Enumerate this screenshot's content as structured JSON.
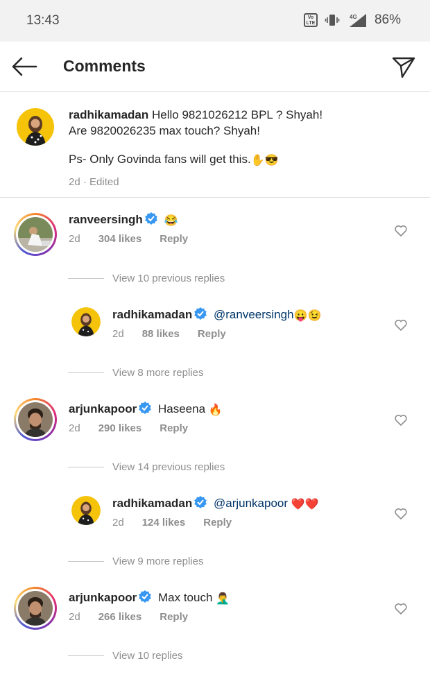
{
  "status": {
    "time": "13:43",
    "battery": "86%",
    "network": "4G",
    "volte": "VoLTE"
  },
  "header": {
    "title": "Comments"
  },
  "caption": {
    "username": "radhikamadan",
    "line1": "Hello 9821026212 BPL ? Shyah!",
    "line2": "Are 9820026235 max touch? Shyah!",
    "line3": "Ps- Only Govinda fans will get this.",
    "emoji": "✋😎",
    "meta": "2d · Edited"
  },
  "comments": [
    {
      "username": "ranveersingh",
      "text": "",
      "emoji": "😂",
      "age": "2d",
      "likes": "304 likes",
      "reply": "Reply"
    },
    {
      "username": "radhikamadan",
      "text": "@ranveersingh",
      "emoji": "😛😉",
      "age": "2d",
      "likes": "88 likes",
      "reply": "Reply"
    },
    {
      "username": "arjunkapoor",
      "text": "Haseena",
      "emoji": "🔥",
      "age": "2d",
      "likes": "290 likes",
      "reply": "Reply"
    },
    {
      "username": "radhikamadan",
      "text": "@arjunkapoor",
      "emoji": "❤️❤️",
      "age": "2d",
      "likes": "124 likes",
      "reply": "Reply"
    },
    {
      "username": "arjunkapoor",
      "text": "Max touch",
      "emoji": "🤦‍♂️",
      "age": "2d",
      "likes": "266 likes",
      "reply": "Reply"
    }
  ],
  "view_replies": [
    "View 10 previous replies",
    "View 8 more replies",
    "View 14 previous replies",
    "View 9 more replies",
    "View 10 replies"
  ],
  "colors": {
    "link": "#003569",
    "muted": "#8e8e8e",
    "verified": "#3897f0",
    "text": "#262626"
  }
}
